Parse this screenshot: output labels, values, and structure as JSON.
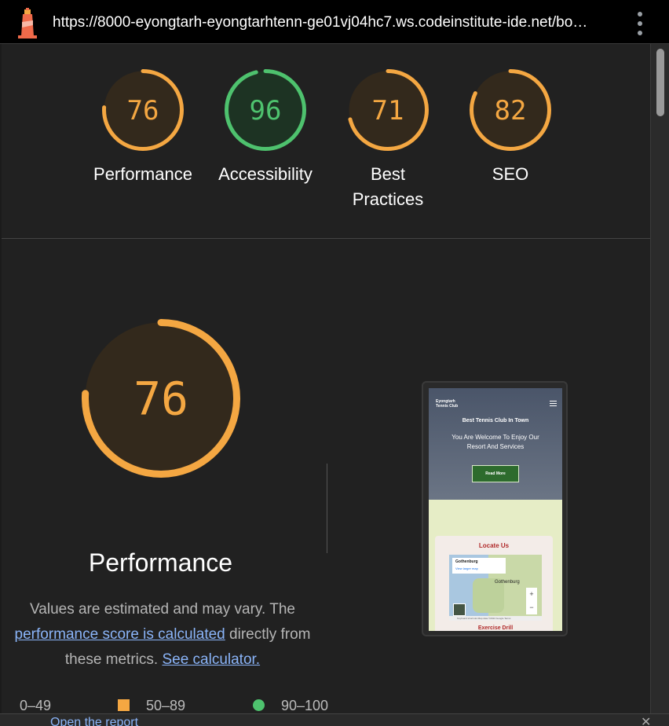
{
  "browser": {
    "url": "https://8000-eyongtarh-eyongtarhtenn-ge01vj04hc7.ws.codeinstitute-ide.net/bo…"
  },
  "summary": [
    {
      "score": "76",
      "label": "Performance",
      "fraction": 0.76,
      "status": "average"
    },
    {
      "score": "96",
      "label": "Accessibility",
      "fraction": 0.96,
      "status": "pass"
    },
    {
      "score": "71",
      "label": "Best Practices",
      "fraction": 0.71,
      "status": "average"
    },
    {
      "score": "82",
      "label": "SEO",
      "fraction": 0.82,
      "status": "average"
    }
  ],
  "performance": {
    "score": "76",
    "fraction": 0.76,
    "title": "Performance",
    "desc_pre": "Values are estimated and may vary. The ",
    "desc_link1": "performance score is calculated",
    "desc_mid": " directly from these metrics. ",
    "desc_link2": "See calculator."
  },
  "legend": {
    "fail": "0–49",
    "average": "50–89",
    "pass": "90–100"
  },
  "colors": {
    "average": "#f4a742",
    "pass": "#4ec26e",
    "average_bg": "#33291c",
    "pass_bg": "#1d3323"
  },
  "screenshot": {
    "site_name_line1": "Eyongtarh",
    "site_name_line2": "Tennis Club",
    "hero_title": "Best Tennis Club In Town",
    "hero_sub": "You Are Welcome To Enjoy Our Resort And Services",
    "button": "Read More",
    "card_title": "Locate Us",
    "map_place": "Gothenburg",
    "map_link": "View larger map",
    "map_city": "Gothenburg",
    "map_footer": "Keyboard shortcuts   Map data ©2024 Google   Terms",
    "next_title": "Exercise Drill"
  },
  "bottom": {
    "text": "Open the report",
    "close": "✕"
  }
}
